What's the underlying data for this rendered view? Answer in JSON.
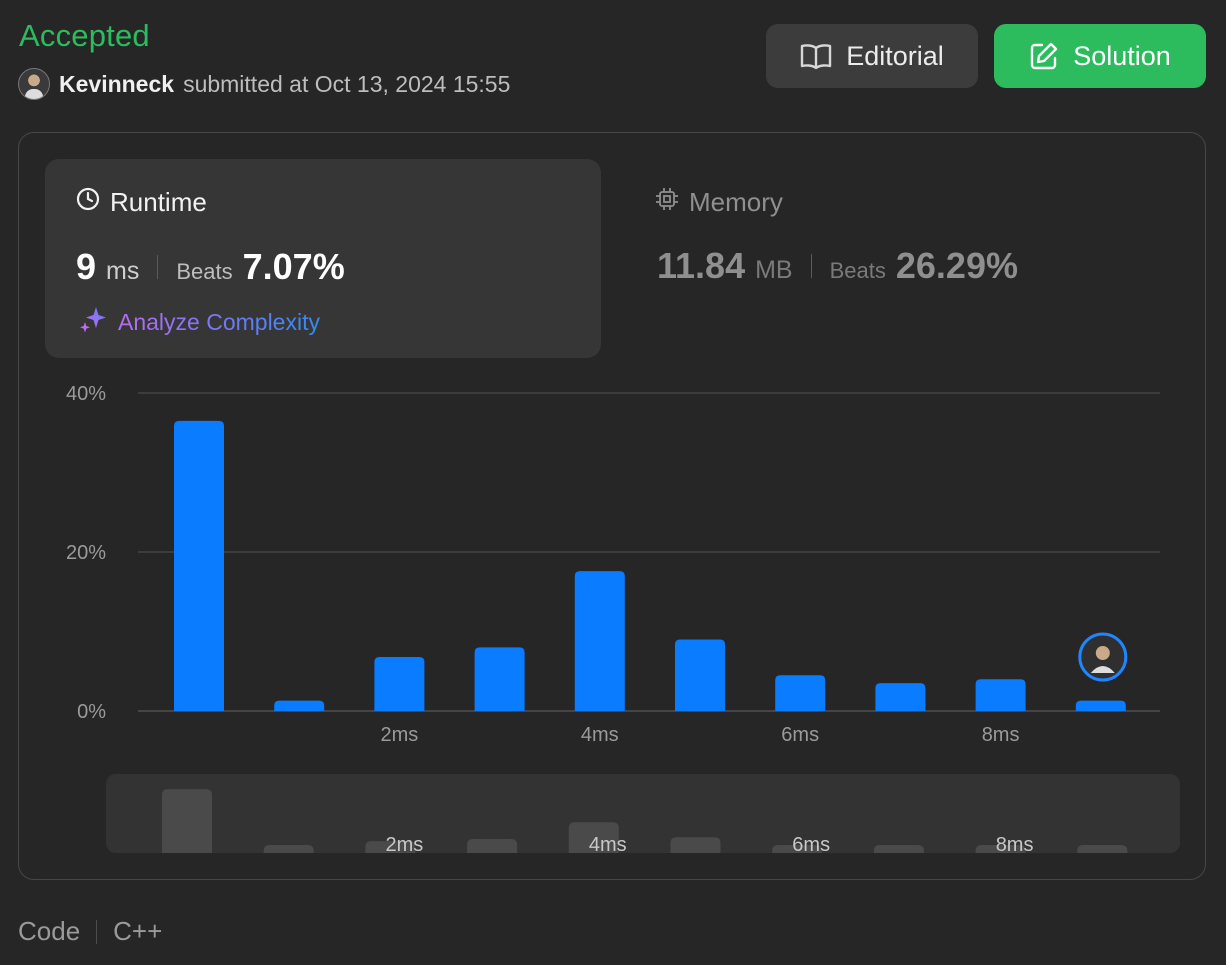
{
  "header": {
    "status": "Accepted",
    "username": "Kevinneck",
    "submitted_text": "submitted at Oct 13, 2024 15:55"
  },
  "actions": {
    "editorial_label": "Editorial",
    "solution_label": "Solution"
  },
  "runtime": {
    "title": "Runtime",
    "value": "9",
    "unit": "ms",
    "beats_label": "Beats",
    "beats_value": "7.07%",
    "analyze_label": "Analyze Complexity"
  },
  "memory": {
    "title": "Memory",
    "value": "11.84",
    "unit": "MB",
    "beats_label": "Beats",
    "beats_value": "26.29%"
  },
  "footer": {
    "code_label": "Code",
    "language": "C++"
  },
  "colors": {
    "accepted": "#2cbb5d",
    "bar": "#0a7cff",
    "preview_bar": "#4a4a4a",
    "background": "#262626"
  },
  "icons": {
    "editorial": "book-open-icon",
    "solution": "edit-square-icon",
    "runtime": "clock-icon",
    "memory": "cpu-chip-icon",
    "analyze": "sparkles-icon"
  },
  "chart_data": {
    "type": "bar",
    "categories": [
      "0ms",
      "1ms",
      "2ms",
      "3ms",
      "4ms",
      "5ms",
      "6ms",
      "7ms",
      "8ms",
      "9ms"
    ],
    "values": [
      36.5,
      1.3,
      6.8,
      8.0,
      17.6,
      9.0,
      4.5,
      3.5,
      4.0,
      1.3
    ],
    "x_tick_labels": [
      "2ms",
      "4ms",
      "6ms",
      "8ms"
    ],
    "y_tick_labels": [
      "40%",
      "20%",
      "0%"
    ],
    "ylim": [
      0,
      40
    ],
    "grid": true,
    "highlight_category": "9ms",
    "preview_tick_labels": [
      "2ms",
      "4ms",
      "6ms",
      "8ms"
    ]
  }
}
